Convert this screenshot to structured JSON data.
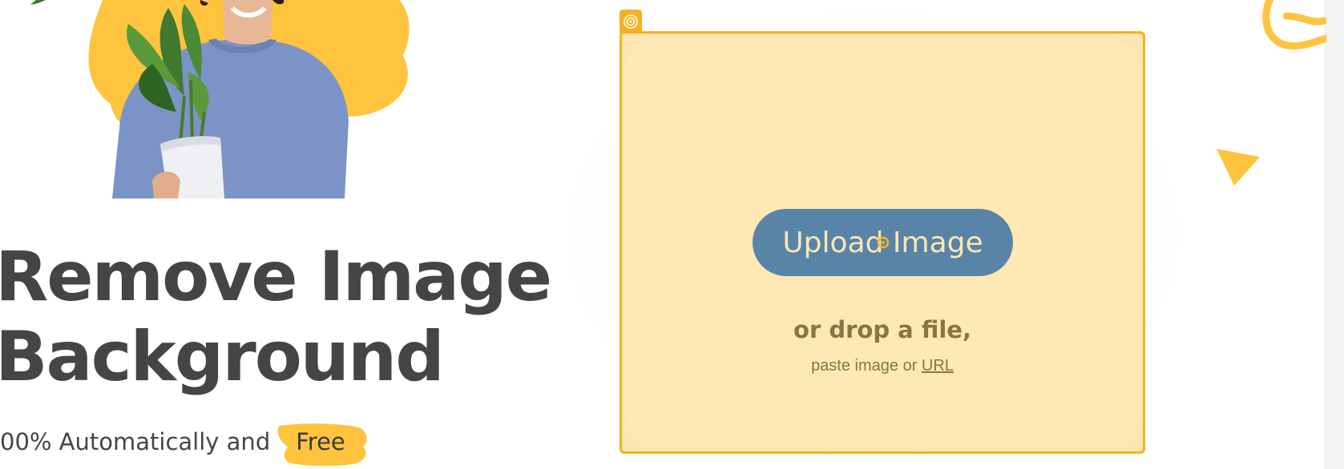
{
  "hero": {
    "headline_line1": "Remove Image",
    "headline_line2": "Background",
    "subline_text": "00% Automatically and",
    "free_label": "Free"
  },
  "upload": {
    "button_label": "Upload Image",
    "drop_text": "or drop a file,",
    "paste_prefix": "paste image or",
    "url_link": "URL"
  },
  "colors": {
    "accent_yellow": "#f4b223",
    "card_bg": "#fde6b2",
    "button_blue": "#5884a8",
    "text_dark": "#454545",
    "text_brown": "#8a7443"
  },
  "icons": {
    "corner_tab": "target-icon",
    "cursor": "crosshair-cursor-icon"
  }
}
